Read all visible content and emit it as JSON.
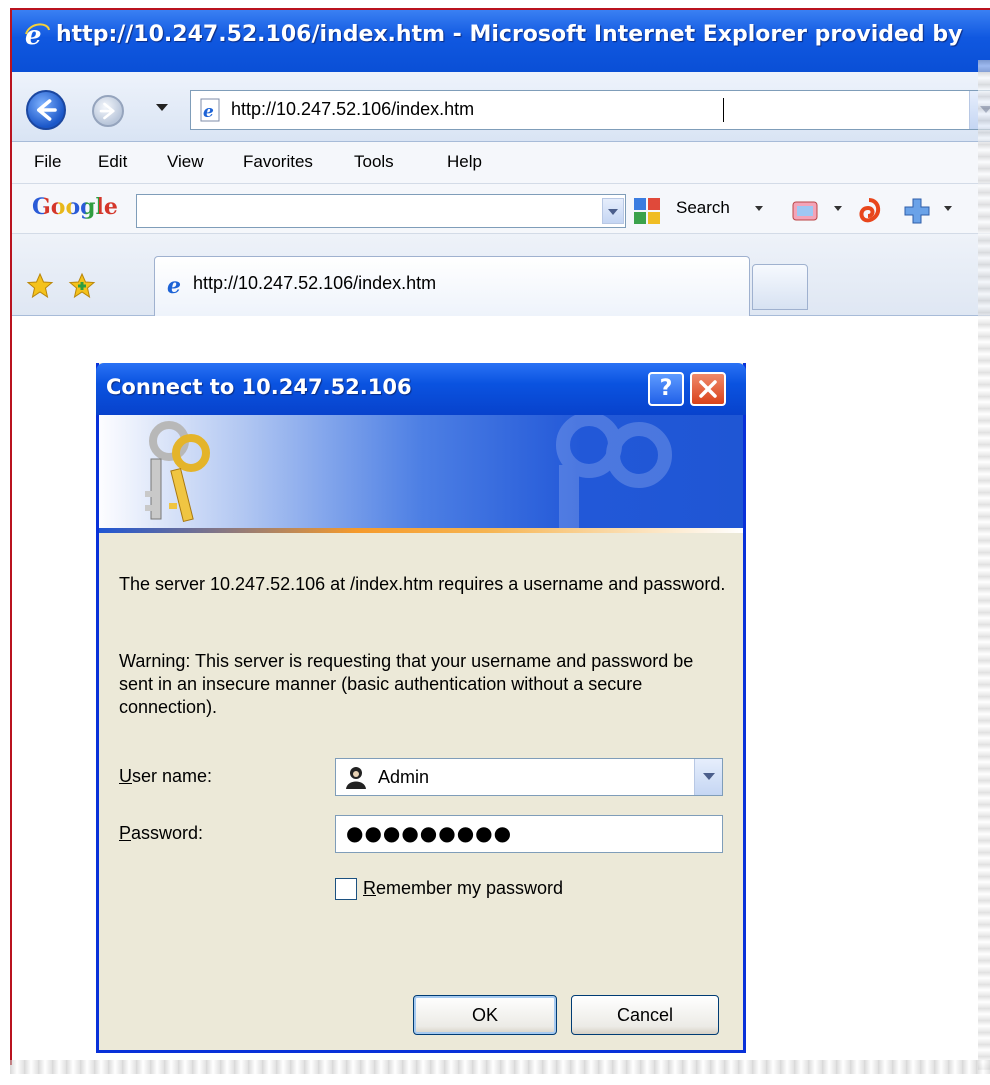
{
  "browser": {
    "window_title": "http://10.247.52.106/index.htm - Microsoft Internet Explorer provided by",
    "address": "http://10.247.52.106/index.htm",
    "menu": [
      "File",
      "Edit",
      "View",
      "Favorites",
      "Tools",
      "Help"
    ],
    "google_toolbar": {
      "logo": "Google",
      "search_label": "Search",
      "search_value": ""
    },
    "tab_label": "http://10.247.52.106/index.htm"
  },
  "dialog": {
    "title": "Connect to 10.247.52.106",
    "help_label": "?",
    "message": "The server 10.247.52.106 at  /index.htm requires a username and password.",
    "warning": "Warning: This server is requesting that your username and password be sent in an insecure manner (basic authentication without a secure connection).",
    "username_label_accel": "U",
    "username_label_rest": "ser name:",
    "username_value": "Admin",
    "password_label_accel": "P",
    "password_label_rest": "assword:",
    "password_value": "●●●●●●●●●",
    "remember_accel": "R",
    "remember_rest": "emember my password",
    "remember_checked": false,
    "ok_label": "OK",
    "cancel_label": "Cancel"
  },
  "colors": {
    "xp_blue": "#0a53e0",
    "dialog_face": "#ece9d8",
    "frame_red": "#b9131f"
  },
  "icons": [
    "ie-logo-icon",
    "back-arrow-icon",
    "forward-arrow-icon",
    "page-icon",
    "google-search-icon",
    "favorites-star-icon",
    "add-favorite-icon",
    "keys-icon",
    "help-icon",
    "close-icon",
    "user-icon"
  ]
}
